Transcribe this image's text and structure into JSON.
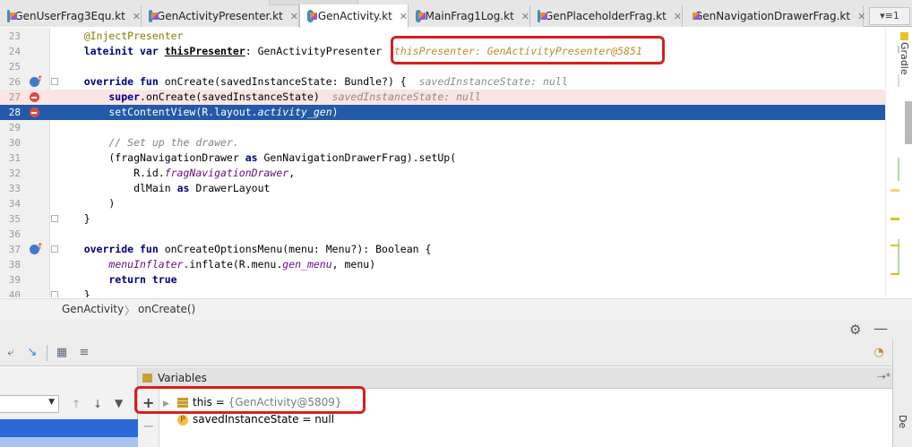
{
  "tabs": [
    {
      "label": "GenUserFrag3Equ.kt"
    },
    {
      "label": "GenActivityPresenter.kt"
    },
    {
      "label": "GenActivity.kt",
      "active": true
    },
    {
      "label": "MainFrag1Log.kt"
    },
    {
      "label": "GenPlaceholderFrag.kt"
    },
    {
      "label": "GenNavigationDrawerFrag.kt"
    }
  ],
  "tab_more_label": "▾≡1",
  "editor": {
    "lines": [
      {
        "num": "23",
        "parts": [
          {
            "t": "    @InjectPresenter",
            "c": "ann"
          }
        ]
      },
      {
        "num": "24",
        "parts": [
          {
            "t": "    lateinit var ",
            "c": "kw"
          },
          {
            "t": "thisPresenter",
            "c": "uline"
          },
          {
            "t": ": GenActivityPresenter  "
          },
          {
            "t": "thisPresenter: GenActivityPresenter@5851",
            "c": "hint-orange"
          }
        ]
      },
      {
        "num": "25",
        "parts": [
          {
            "t": ""
          }
        ]
      },
      {
        "num": "26",
        "parts": [
          {
            "t": "    override fun ",
            "c": "kw"
          },
          {
            "t": "onCreate(savedInstanceState: Bundle?) {  "
          },
          {
            "t": "savedInstanceState: null",
            "c": "hint"
          }
        ]
      },
      {
        "num": "27",
        "parts": [
          {
            "t": "        super",
            "c": "kw"
          },
          {
            "t": ".onCreate(savedInstanceState)  "
          },
          {
            "t": "savedInstanceState: null",
            "c": "hint"
          }
        ]
      },
      {
        "num": "28",
        "parts": [
          {
            "t": "        setContentView(R.layout."
          },
          {
            "t": "activity_gen",
            "c": "ital-purple"
          },
          {
            "t": ")"
          }
        ]
      },
      {
        "num": "29",
        "parts": [
          {
            "t": ""
          }
        ]
      },
      {
        "num": "30",
        "parts": [
          {
            "t": "        // Set up the drawer.",
            "c": "cmt"
          }
        ]
      },
      {
        "num": "31",
        "parts": [
          {
            "t": "        (fragNavigationDrawer "
          },
          {
            "t": "as",
            "c": "kw"
          },
          {
            "t": " GenNavigationDrawerFrag).setUp("
          }
        ]
      },
      {
        "num": "32",
        "parts": [
          {
            "t": "            R.id."
          },
          {
            "t": "fragNavigationDrawer",
            "c": "ital-purple"
          },
          {
            "t": ","
          }
        ]
      },
      {
        "num": "33",
        "parts": [
          {
            "t": "            dlMain "
          },
          {
            "t": "as",
            "c": "kw"
          },
          {
            "t": " DrawerLayout"
          }
        ]
      },
      {
        "num": "34",
        "parts": [
          {
            "t": "        )"
          }
        ]
      },
      {
        "num": "35",
        "parts": [
          {
            "t": "    }"
          }
        ]
      },
      {
        "num": "36",
        "parts": [
          {
            "t": ""
          }
        ]
      },
      {
        "num": "37",
        "parts": [
          {
            "t": "    override fun ",
            "c": "kw"
          },
          {
            "t": "onCreateOptionsMenu(menu: Menu?): Boolean {"
          }
        ]
      },
      {
        "num": "38",
        "parts": [
          {
            "t": "        "
          },
          {
            "t": "menuInflater",
            "c": "ital-purple"
          },
          {
            "t": ".inflate(R.menu."
          },
          {
            "t": "gen_menu",
            "c": "ital-purple"
          },
          {
            "t": ", menu)"
          }
        ]
      },
      {
        "num": "39",
        "parts": [
          {
            "t": "        return true",
            "c": "kw"
          }
        ]
      },
      {
        "num": "40",
        "parts": [
          {
            "t": "    }"
          }
        ]
      }
    ]
  },
  "side_tool": {
    "gradle_label": "Gradle"
  },
  "breadcrumb": {
    "class_name": "GenActivity",
    "method_name": "onCreate()"
  },
  "variables": {
    "header": "Variables",
    "rows": [
      {
        "name": "this",
        "eq": " = ",
        "value": "{GenActivity@5809}",
        "kind": "object"
      },
      {
        "name": "savedInstanceState",
        "eq": " = ",
        "value": "null",
        "kind": "param"
      }
    ]
  },
  "debugger_strip_label": "De"
}
